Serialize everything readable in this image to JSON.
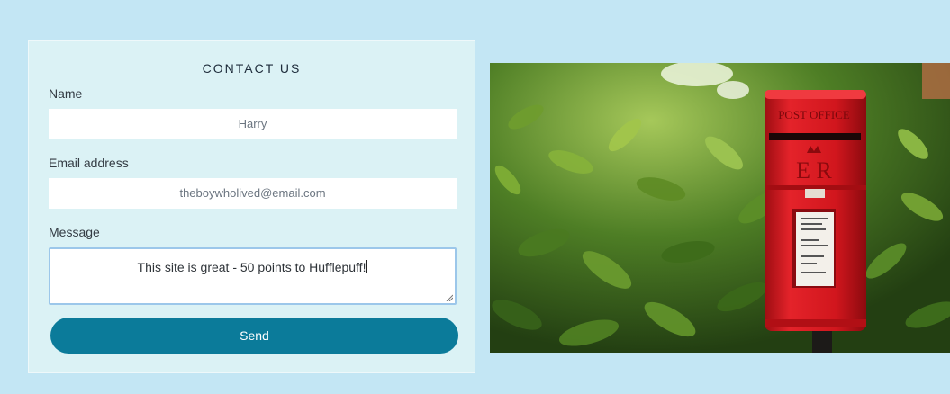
{
  "contact_form": {
    "title": "CONTACT US",
    "name_label": "Name",
    "name_value": "Harry",
    "email_label": "Email address",
    "email_value": "theboywholived@email.com",
    "message_label": "Message",
    "message_value": "This site is great - 50 points to Hufflepuff!",
    "send_label": "Send"
  },
  "photo": {
    "postbox_sign": "POST OFFICE",
    "postbox_cipher": "E R"
  },
  "colors": {
    "page_background": "#c3e6f4",
    "card_background": "#dbf2f5",
    "send_button": "#0b7b9a",
    "postbox_red": "#d9161c"
  }
}
